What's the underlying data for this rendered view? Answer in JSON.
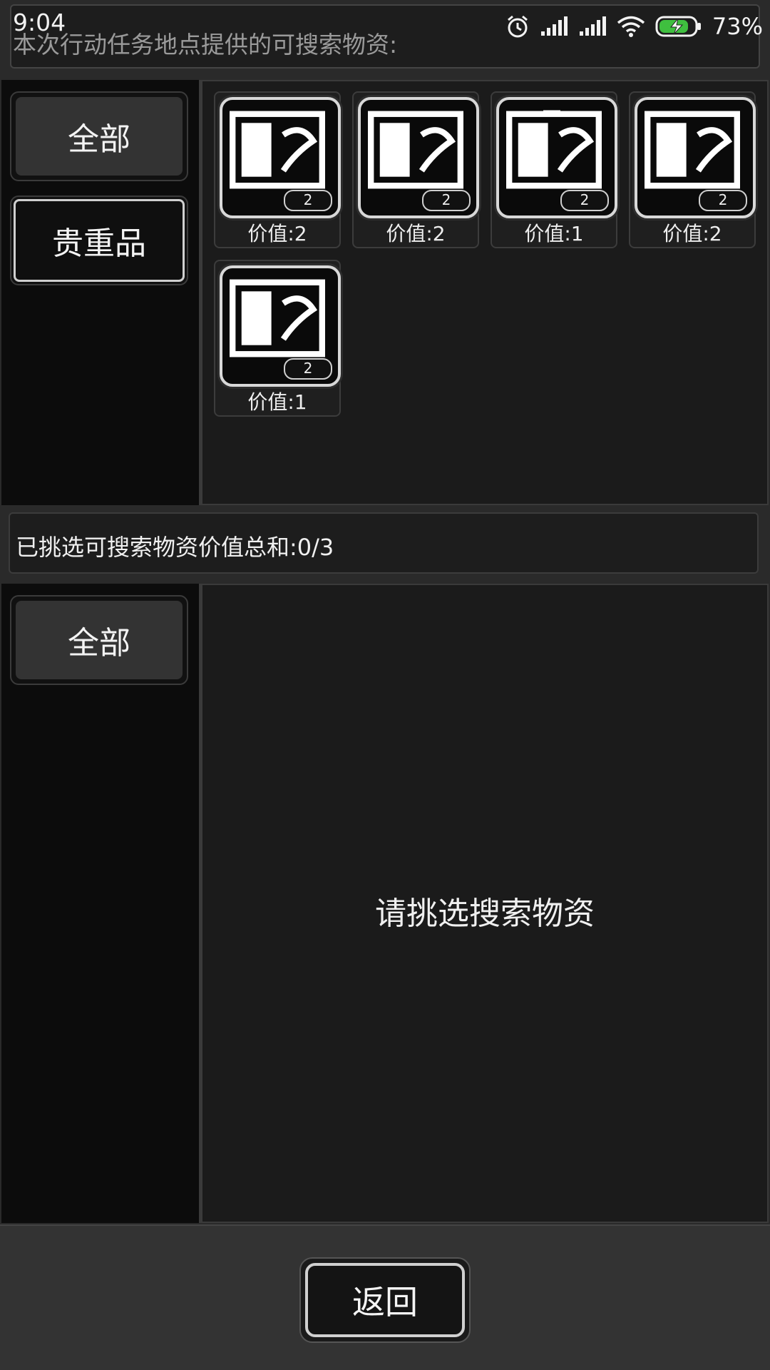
{
  "status_bar": {
    "time": "9:04",
    "battery_percent": "73%",
    "icons": [
      "alarm-icon",
      "signal-icon",
      "signal-icon",
      "wifi-icon",
      "battery-charging-icon"
    ]
  },
  "header": {
    "title": "本次行动任务地点提供的可搜索物资:"
  },
  "top_panel": {
    "categories": [
      {
        "label": "全部",
        "state": "active"
      },
      {
        "label": "贵重品",
        "state": "outlined"
      }
    ],
    "items": [
      {
        "icon": "probe-wand-icon",
        "quantity": "2",
        "value_label": "价值:2"
      },
      {
        "icon": "microchip-icon",
        "quantity": "2",
        "value_label": "价值:2"
      },
      {
        "icon": "lab-flask-icon",
        "quantity": "2",
        "value_label": "价值:1"
      },
      {
        "icon": "electronic-module-icon",
        "quantity": "2",
        "value_label": "价值:2"
      },
      {
        "icon": "grid-panel-icon",
        "quantity": "2",
        "value_label": "价值:1"
      }
    ]
  },
  "summary": {
    "text": "已挑选可搜索物资价值总和:0/3"
  },
  "bottom_panel": {
    "categories": [
      {
        "label": "全部",
        "state": "active"
      }
    ],
    "empty_prompt": "请挑选搜索物资"
  },
  "footer": {
    "back_label": "返回"
  }
}
